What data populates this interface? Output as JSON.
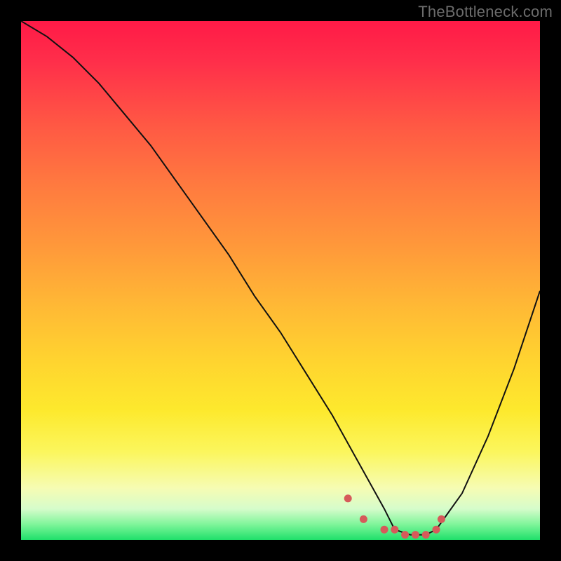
{
  "watermark": "TheBottleneck.com",
  "chart_data": {
    "type": "line",
    "title": "",
    "xlabel": "",
    "ylabel": "",
    "xlim": [
      0,
      100
    ],
    "ylim": [
      0,
      100
    ],
    "grid": false,
    "series": [
      {
        "name": "curve",
        "x": [
          0,
          5,
          10,
          15,
          20,
          25,
          30,
          35,
          40,
          45,
          50,
          55,
          60,
          65,
          70,
          72,
          75,
          78,
          80,
          85,
          90,
          95,
          100
        ],
        "values": [
          100,
          97,
          93,
          88,
          82,
          76,
          69,
          62,
          55,
          47,
          40,
          32,
          24,
          15,
          6,
          2,
          1,
          1,
          2,
          9,
          20,
          33,
          48
        ]
      }
    ],
    "markers": {
      "name": "floor-markers",
      "color": "#d65a5a",
      "x": [
        63,
        66,
        70,
        72,
        74,
        76,
        78,
        80,
        81
      ],
      "values": [
        8,
        4,
        2,
        2,
        1,
        1,
        1,
        2,
        4
      ]
    },
    "background": {
      "type": "vertical-gradient",
      "stops": [
        {
          "pos": 0.0,
          "color": "#ff1a47"
        },
        {
          "pos": 0.2,
          "color": "#ff5844"
        },
        {
          "pos": 0.44,
          "color": "#ff9a3a"
        },
        {
          "pos": 0.66,
          "color": "#ffd52f"
        },
        {
          "pos": 0.83,
          "color": "#fbf65d"
        },
        {
          "pos": 0.94,
          "color": "#d6fccb"
        },
        {
          "pos": 1.0,
          "color": "#1fe06a"
        }
      ]
    }
  }
}
